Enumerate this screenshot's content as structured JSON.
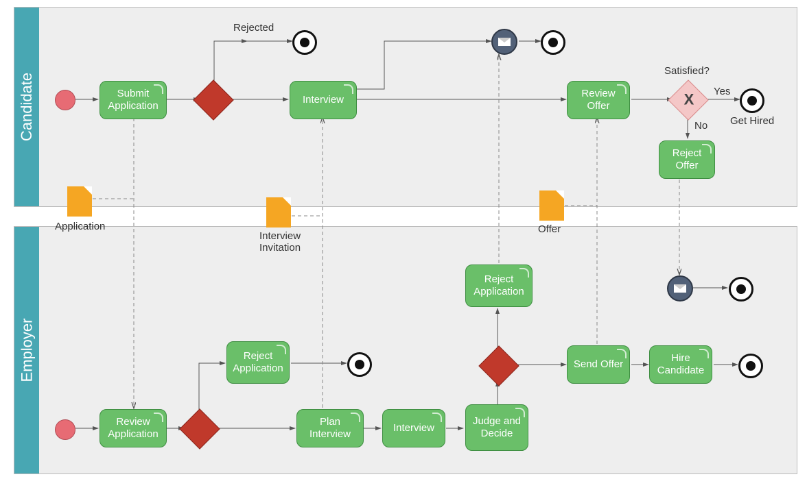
{
  "lanes": {
    "candidate": "Candidate",
    "employer": "Employer"
  },
  "candidate": {
    "submit": "Submit Application",
    "interview": "Interview",
    "reviewOffer": "Review Offer",
    "rejectOffer": "Reject Offer",
    "rejected": "Rejected",
    "satisfied": "Satisfied?",
    "yes": "Yes",
    "no": "No",
    "getHired": "Get Hired"
  },
  "employer": {
    "reviewApp": "Review Application",
    "rejectApp1": "Reject Application",
    "planInterview": "Plan Interview",
    "interview": "Interview",
    "judge": "Judge and Decide",
    "rejectApp2": "Reject Application",
    "sendOffer": "Send Offer",
    "hire": "Hire Candidate"
  },
  "dataobjects": {
    "application": "Application",
    "invitation": "Interview Invitation",
    "offer": "Offer"
  }
}
